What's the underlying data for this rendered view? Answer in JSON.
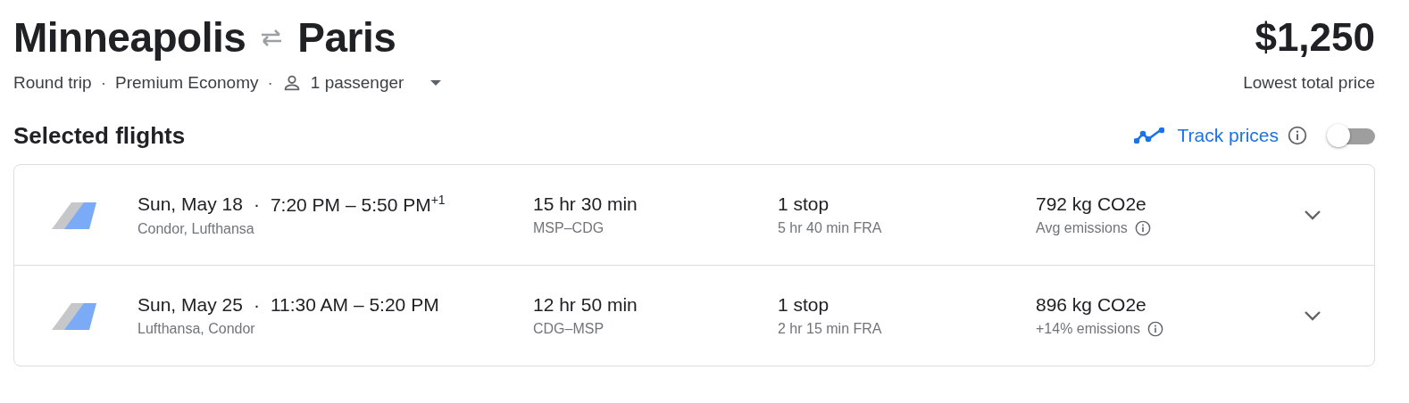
{
  "route": {
    "origin": "Minneapolis",
    "destination": "Paris"
  },
  "trip": {
    "type": "Round trip",
    "separator_1": "·",
    "cabin": "Premium Economy",
    "separator_2": "·",
    "passengers": "1 passenger"
  },
  "price": {
    "amount": "$1,250",
    "caption": "Lowest total price"
  },
  "section_title": "Selected flights",
  "track_prices": {
    "label": "Track prices",
    "on": false
  },
  "flights": [
    {
      "date": "Sun, May 18",
      "separator": "·",
      "times": "7:20 PM – 5:50 PM$^{+1}$",
      "airlines": "Condor, Lufthansa",
      "duration": "15 hr 30 min",
      "route": "MSP–CDG",
      "stops": "1 stop",
      "layover": "5 hr 40 min FRA",
      "emissions": "792 kg CO2e",
      "emissions_note": "Avg emissions",
      "expanded": false
    },
    {
      "date": "Sun, May 25",
      "separator": "·",
      "times": "11:30 AM – 5:20 PM",
      "airlines": "Lufthansa, Condor",
      "duration": "12 hr 50 min",
      "route": "CDG–MSP",
      "stops": "1 stop",
      "layover": "2 hr 15 min FRA",
      "emissions": "896 kg CO2e",
      "emissions_note": "+14% emissions",
      "expanded": false
    }
  ]
}
